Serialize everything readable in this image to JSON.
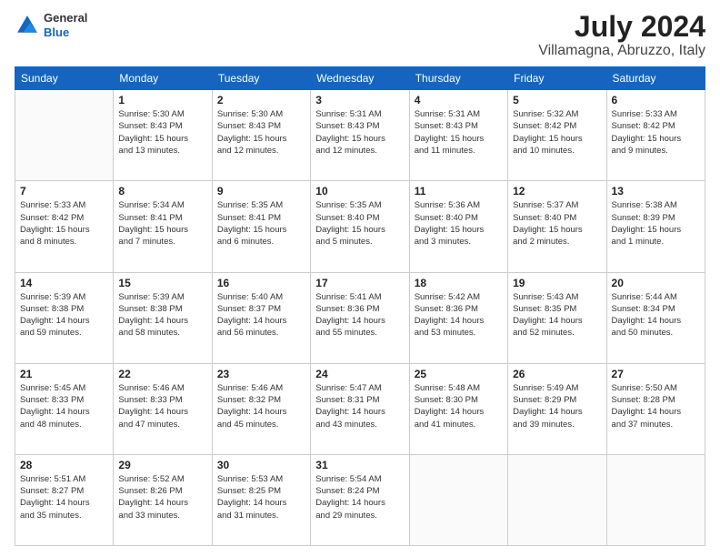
{
  "logo": {
    "line1": "General",
    "line2": "Blue"
  },
  "title": "July 2024",
  "subtitle": "Villamagna, Abruzzo, Italy",
  "weekdays": [
    "Sunday",
    "Monday",
    "Tuesday",
    "Wednesday",
    "Thursday",
    "Friday",
    "Saturday"
  ],
  "weeks": [
    [
      {
        "day": "",
        "info": ""
      },
      {
        "day": "1",
        "info": "Sunrise: 5:30 AM\nSunset: 8:43 PM\nDaylight: 15 hours\nand 13 minutes."
      },
      {
        "day": "2",
        "info": "Sunrise: 5:30 AM\nSunset: 8:43 PM\nDaylight: 15 hours\nand 12 minutes."
      },
      {
        "day": "3",
        "info": "Sunrise: 5:31 AM\nSunset: 8:43 PM\nDaylight: 15 hours\nand 12 minutes."
      },
      {
        "day": "4",
        "info": "Sunrise: 5:31 AM\nSunset: 8:43 PM\nDaylight: 15 hours\nand 11 minutes."
      },
      {
        "day": "5",
        "info": "Sunrise: 5:32 AM\nSunset: 8:42 PM\nDaylight: 15 hours\nand 10 minutes."
      },
      {
        "day": "6",
        "info": "Sunrise: 5:33 AM\nSunset: 8:42 PM\nDaylight: 15 hours\nand 9 minutes."
      }
    ],
    [
      {
        "day": "7",
        "info": "Sunrise: 5:33 AM\nSunset: 8:42 PM\nDaylight: 15 hours\nand 8 minutes."
      },
      {
        "day": "8",
        "info": "Sunrise: 5:34 AM\nSunset: 8:41 PM\nDaylight: 15 hours\nand 7 minutes."
      },
      {
        "day": "9",
        "info": "Sunrise: 5:35 AM\nSunset: 8:41 PM\nDaylight: 15 hours\nand 6 minutes."
      },
      {
        "day": "10",
        "info": "Sunrise: 5:35 AM\nSunset: 8:40 PM\nDaylight: 15 hours\nand 5 minutes."
      },
      {
        "day": "11",
        "info": "Sunrise: 5:36 AM\nSunset: 8:40 PM\nDaylight: 15 hours\nand 3 minutes."
      },
      {
        "day": "12",
        "info": "Sunrise: 5:37 AM\nSunset: 8:40 PM\nDaylight: 15 hours\nand 2 minutes."
      },
      {
        "day": "13",
        "info": "Sunrise: 5:38 AM\nSunset: 8:39 PM\nDaylight: 15 hours\nand 1 minute."
      }
    ],
    [
      {
        "day": "14",
        "info": "Sunrise: 5:39 AM\nSunset: 8:38 PM\nDaylight: 14 hours\nand 59 minutes."
      },
      {
        "day": "15",
        "info": "Sunrise: 5:39 AM\nSunset: 8:38 PM\nDaylight: 14 hours\nand 58 minutes."
      },
      {
        "day": "16",
        "info": "Sunrise: 5:40 AM\nSunset: 8:37 PM\nDaylight: 14 hours\nand 56 minutes."
      },
      {
        "day": "17",
        "info": "Sunrise: 5:41 AM\nSunset: 8:36 PM\nDaylight: 14 hours\nand 55 minutes."
      },
      {
        "day": "18",
        "info": "Sunrise: 5:42 AM\nSunset: 8:36 PM\nDaylight: 14 hours\nand 53 minutes."
      },
      {
        "day": "19",
        "info": "Sunrise: 5:43 AM\nSunset: 8:35 PM\nDaylight: 14 hours\nand 52 minutes."
      },
      {
        "day": "20",
        "info": "Sunrise: 5:44 AM\nSunset: 8:34 PM\nDaylight: 14 hours\nand 50 minutes."
      }
    ],
    [
      {
        "day": "21",
        "info": "Sunrise: 5:45 AM\nSunset: 8:33 PM\nDaylight: 14 hours\nand 48 minutes."
      },
      {
        "day": "22",
        "info": "Sunrise: 5:46 AM\nSunset: 8:33 PM\nDaylight: 14 hours\nand 47 minutes."
      },
      {
        "day": "23",
        "info": "Sunrise: 5:46 AM\nSunset: 8:32 PM\nDaylight: 14 hours\nand 45 minutes."
      },
      {
        "day": "24",
        "info": "Sunrise: 5:47 AM\nSunset: 8:31 PM\nDaylight: 14 hours\nand 43 minutes."
      },
      {
        "day": "25",
        "info": "Sunrise: 5:48 AM\nSunset: 8:30 PM\nDaylight: 14 hours\nand 41 minutes."
      },
      {
        "day": "26",
        "info": "Sunrise: 5:49 AM\nSunset: 8:29 PM\nDaylight: 14 hours\nand 39 minutes."
      },
      {
        "day": "27",
        "info": "Sunrise: 5:50 AM\nSunset: 8:28 PM\nDaylight: 14 hours\nand 37 minutes."
      }
    ],
    [
      {
        "day": "28",
        "info": "Sunrise: 5:51 AM\nSunset: 8:27 PM\nDaylight: 14 hours\nand 35 minutes."
      },
      {
        "day": "29",
        "info": "Sunrise: 5:52 AM\nSunset: 8:26 PM\nDaylight: 14 hours\nand 33 minutes."
      },
      {
        "day": "30",
        "info": "Sunrise: 5:53 AM\nSunset: 8:25 PM\nDaylight: 14 hours\nand 31 minutes."
      },
      {
        "day": "31",
        "info": "Sunrise: 5:54 AM\nSunset: 8:24 PM\nDaylight: 14 hours\nand 29 minutes."
      },
      {
        "day": "",
        "info": ""
      },
      {
        "day": "",
        "info": ""
      },
      {
        "day": "",
        "info": ""
      }
    ]
  ],
  "colors": {
    "header_bg": "#1565c0",
    "header_text": "#ffffff",
    "border": "#cccccc",
    "title": "#222222",
    "subtitle": "#444444",
    "logo_blue": "#1565c0"
  }
}
